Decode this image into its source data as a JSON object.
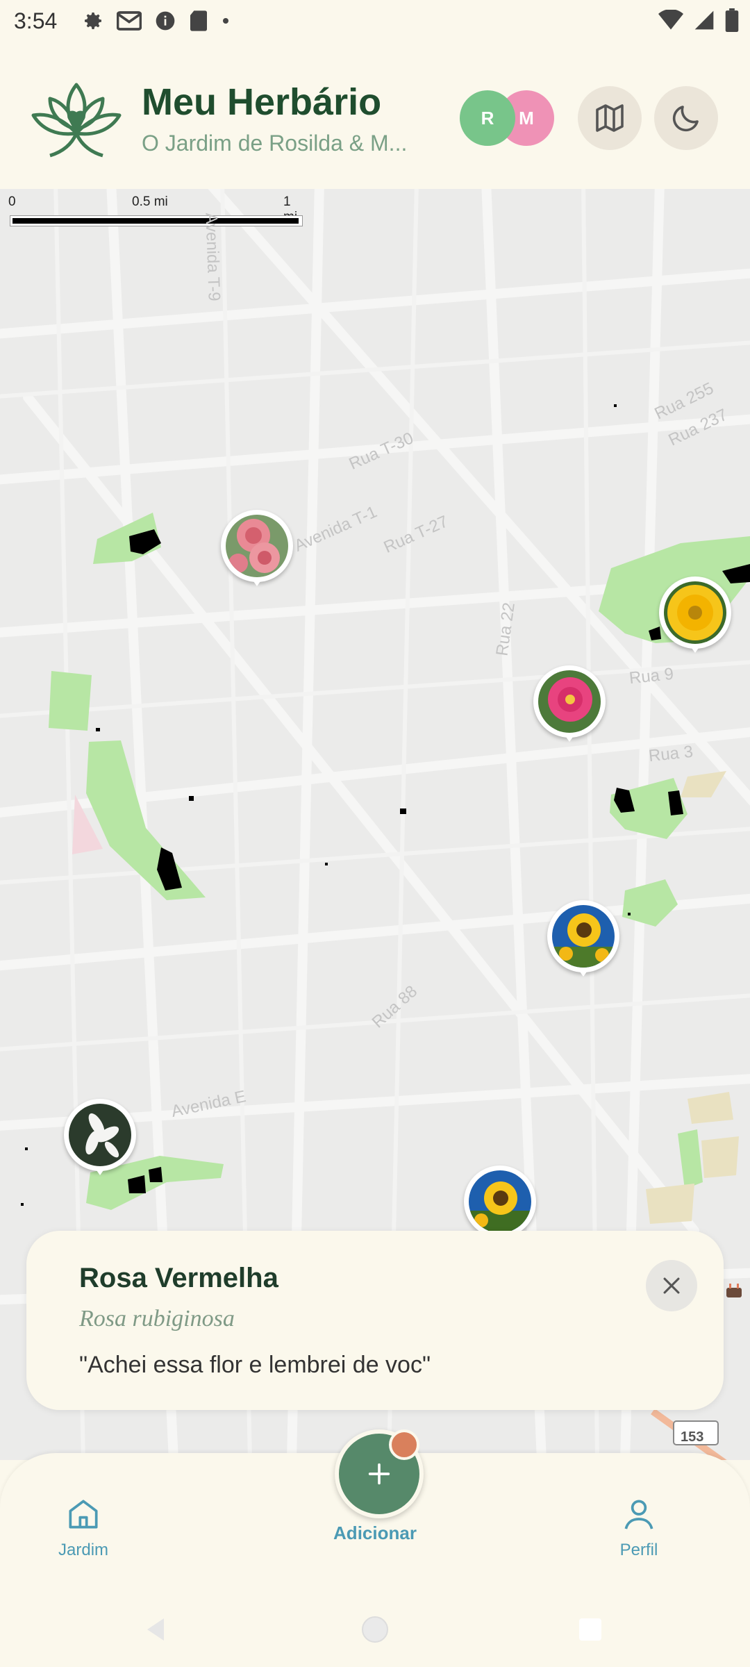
{
  "status_bar": {
    "time": "3:54"
  },
  "header": {
    "title": "Meu Herbário",
    "subtitle": "O Jardim de Rosilda & M...",
    "avatars": [
      {
        "initial": "R",
        "color": "#78c58a"
      },
      {
        "initial": "M",
        "color": "#ef92b6"
      }
    ],
    "map_button_icon": "map-icon",
    "theme_button_icon": "moon-icon"
  },
  "map": {
    "scale": {
      "zero": "0",
      "half": "0.5 mi",
      "one": "1 mi"
    },
    "streets": [
      "Rua T-30",
      "Avenida T-1",
      "Rua T-27",
      "Rua 22",
      "Rua 9",
      "Rua 3",
      "Rua 88",
      "Avenida E",
      "Avenida T-9",
      "Rua 255",
      "Rua 237"
    ],
    "route_badge": "153",
    "markers": [
      {
        "flower": "pink-rose"
      },
      {
        "flower": "yellow-gerbera"
      },
      {
        "flower": "pink-zinnia"
      },
      {
        "flower": "sunflower"
      },
      {
        "flower": "white-jasmine"
      },
      {
        "flower": "sunflower"
      }
    ]
  },
  "card": {
    "name": "Rosa Vermelha",
    "scientific_name": "Rosa rubiginosa",
    "message": "\"Achei essa flor e lembrei de voc\""
  },
  "nav": {
    "home_label": "Jardim",
    "add_label": "Adicionar",
    "profile_label": "Perfil"
  },
  "colors": {
    "accent": "#56896a",
    "title": "#1f4d2e",
    "nav_label": "#4b9ab4",
    "park": "#b7e6a4"
  }
}
